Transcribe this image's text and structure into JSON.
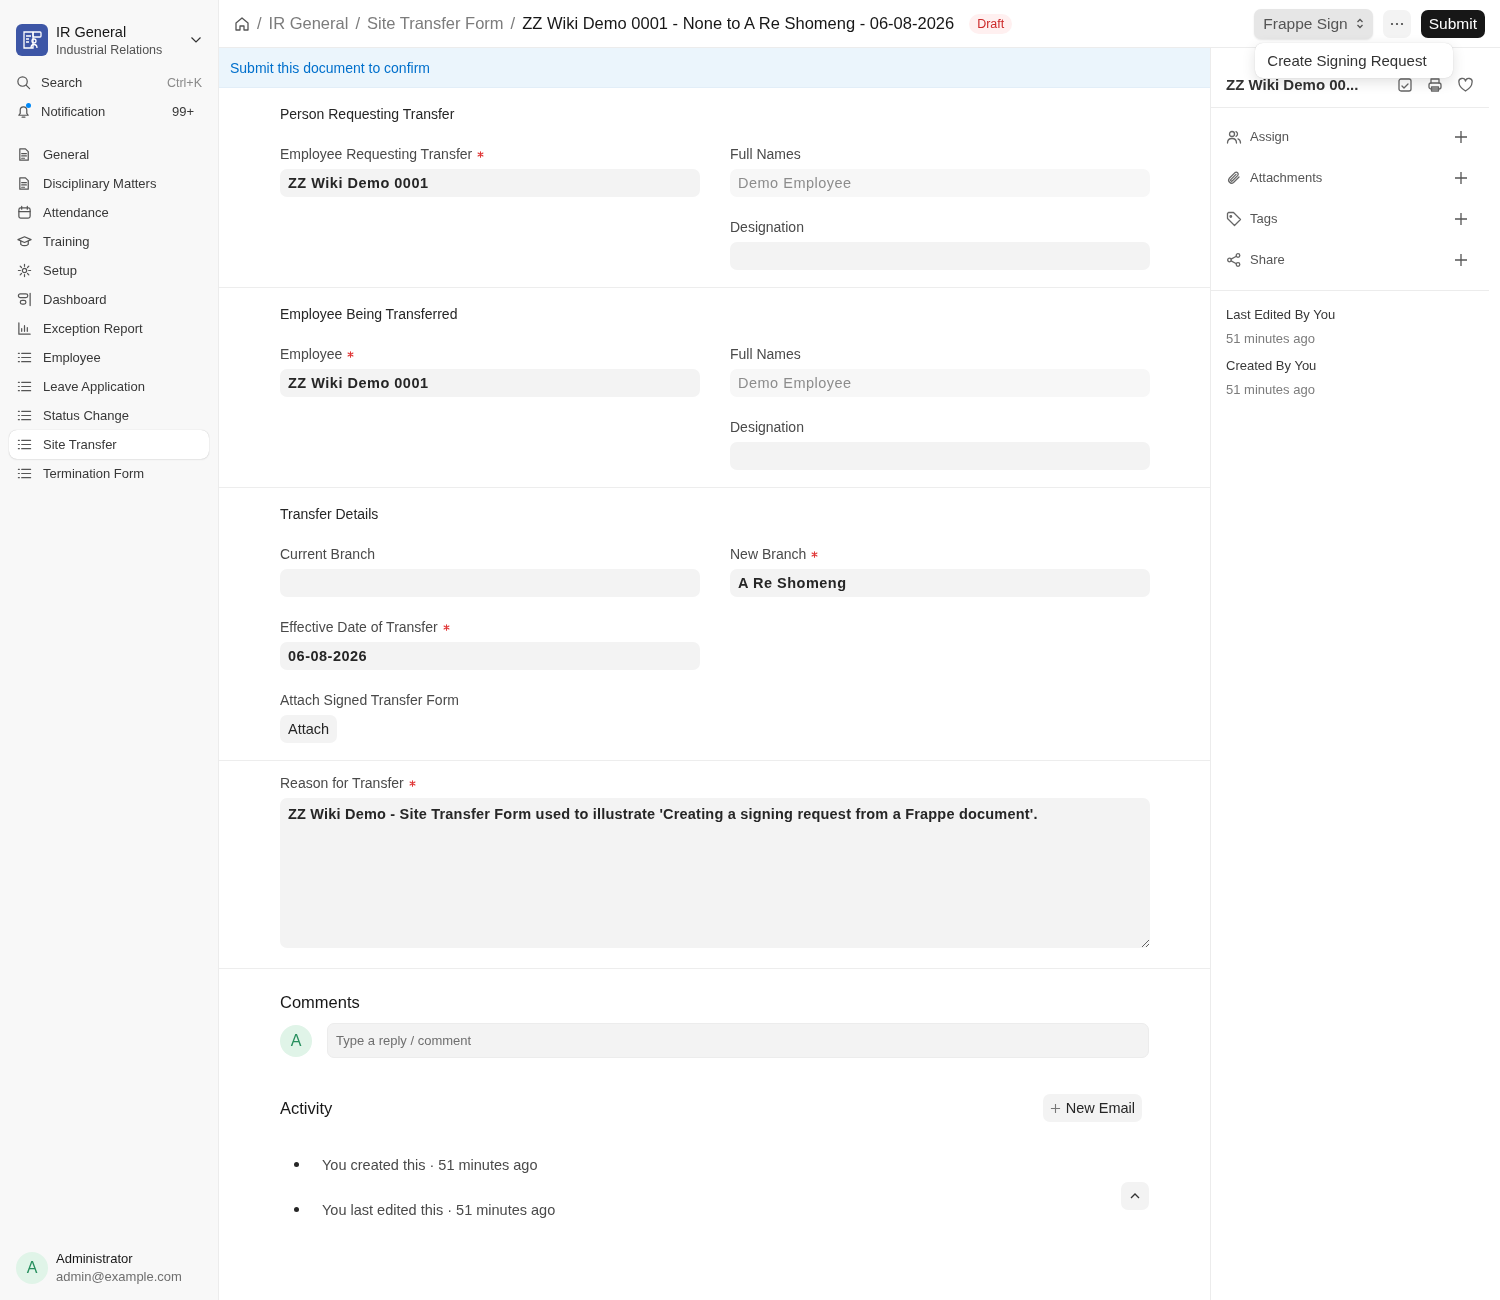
{
  "app": {
    "title": "IR General",
    "subtitle": "Industrial Relations"
  },
  "sidebar": {
    "search": {
      "label": "Search",
      "shortcut": "Ctrl+K"
    },
    "notification": {
      "label": "Notification",
      "count": "99+",
      "unread": true
    },
    "items": [
      {
        "label": "General",
        "kind": "doc",
        "selected": false
      },
      {
        "label": "Disciplinary Matters",
        "kind": "doc",
        "selected": false
      },
      {
        "label": "Attendance",
        "kind": "calendar",
        "selected": false
      },
      {
        "label": "Training",
        "kind": "cap",
        "selected": false
      },
      {
        "label": "Setup",
        "kind": "gear",
        "selected": false
      },
      {
        "label": "Dashboard",
        "kind": "dashboard",
        "selected": false
      },
      {
        "label": "Exception Report",
        "kind": "chart",
        "selected": false
      },
      {
        "label": "Employee",
        "kind": "list",
        "selected": false
      },
      {
        "label": "Leave Application",
        "kind": "list",
        "selected": false
      },
      {
        "label": "Status Change",
        "kind": "list",
        "selected": false
      },
      {
        "label": "Site Transfer",
        "kind": "list",
        "selected": true
      },
      {
        "label": "Termination Form",
        "kind": "list",
        "selected": false
      }
    ]
  },
  "user": {
    "initial": "A",
    "name": "Administrator",
    "email": "admin@example.com"
  },
  "breadcrumbs": [
    {
      "separator": "/",
      "label": "IR General"
    },
    {
      "separator": "/",
      "label": "Site Transfer Form"
    },
    {
      "separator": "/",
      "label": "ZZ Wiki Demo 0001 - None to A Re Shomeng - 06-08-2026"
    }
  ],
  "status": "Draft",
  "actions": {
    "menu": {
      "label": "Frappe Sign",
      "items": [
        "Create Signing Request"
      ]
    },
    "primary": "Submit"
  },
  "notice": "Submit this document to confirm",
  "sections": [
    {
      "title": "Person Requesting Transfer",
      "columns": [
        [
          {
            "label": "Employee Requesting Transfer",
            "required": true,
            "kind": "text",
            "value": "ZZ Wiki Demo 0001",
            "readonly": false
          }
        ],
        [
          {
            "label": "Full Names",
            "required": false,
            "kind": "text",
            "value": "Demo Employee",
            "readonly": true
          },
          {
            "label": "Designation",
            "required": false,
            "kind": "text"
          }
        ]
      ]
    },
    {
      "title": "Employee Being Transferred",
      "columns": [
        [
          {
            "label": "Employee",
            "required": true,
            "kind": "text",
            "value": "ZZ Wiki Demo 0001",
            "readonly": false
          }
        ],
        [
          {
            "label": "Full Names",
            "required": false,
            "kind": "text",
            "value": "Demo Employee",
            "readonly": true
          },
          {
            "label": "Designation",
            "required": false,
            "kind": "text"
          }
        ]
      ]
    },
    {
      "title": "Transfer Details",
      "columns": [
        [
          {
            "label": "Current Branch",
            "required": false,
            "kind": "text"
          },
          {
            "label": "Effective Date of Transfer",
            "required": true,
            "kind": "text",
            "value": "06-08-2026",
            "readonly": false
          },
          {
            "label": "Attach Signed Transfer Form",
            "required": false,
            "kind": "attach",
            "value": "Attach"
          }
        ],
        [
          {
            "label": "New Branch",
            "required": true,
            "kind": "text",
            "value": "A Re Shomeng",
            "readonly": false
          }
        ]
      ]
    },
    {
      "columns": [
        [
          {
            "label": "Reason for Transfer",
            "required": true,
            "kind": "textarea",
            "value": "ZZ Wiki Demo - Site Transfer Form used to illustrate 'Creating a signing request from a Frappe document'."
          }
        ]
      ]
    }
  ],
  "comments": {
    "title": "Comments",
    "initial": "A",
    "placeholder": "Type a reply / comment"
  },
  "activity": {
    "title": "Activity",
    "button": "New Email",
    "items": [
      "You created this · 51 minutes ago",
      "You last edited this · 51 minutes ago"
    ]
  },
  "panel": {
    "title": "ZZ Wiki Demo 00...",
    "actions": [
      {
        "label": "Assign",
        "kind": "users"
      },
      {
        "label": "Attachments",
        "kind": "clip"
      },
      {
        "label": "Tags",
        "kind": "tag"
      },
      {
        "label": "Share",
        "kind": "share"
      }
    ],
    "meta": [
      {
        "label": "Last Edited By You",
        "time": "51 minutes ago"
      },
      {
        "label": "Created By You",
        "time": "51 minutes ago"
      }
    ]
  }
}
